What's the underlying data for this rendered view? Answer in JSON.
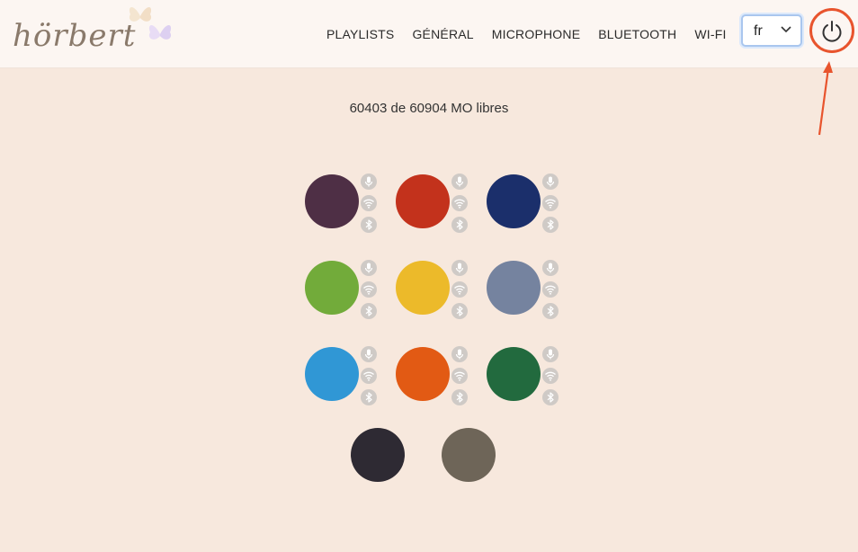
{
  "app": {
    "logo_text": "hörbert"
  },
  "nav": {
    "items": [
      "PLAYLISTS",
      "GÉNÉRAL",
      "MICROPHONE",
      "BLUETOOTH",
      "WI-FI"
    ]
  },
  "language": {
    "selected": "fr"
  },
  "storage": {
    "text": "60403 de 60904 MO libres"
  },
  "icons": {
    "power": "power-icon",
    "microphone": "microphone-icon",
    "wifi": "wifi-icon",
    "bluetooth": "bluetooth-icon",
    "chevron": "chevron-down-icon"
  },
  "colors": {
    "accent": "#e8542d",
    "page_bg": "#f7e8dd",
    "header_bg": "#fcf6f2"
  },
  "playlists": [
    {
      "color": "#4e2f45",
      "badges": true
    },
    {
      "color": "#c3321c",
      "badges": true
    },
    {
      "color": "#1b2f6b",
      "badges": true
    },
    {
      "color": "#72ab3a",
      "badges": true
    },
    {
      "color": "#ecba2a",
      "badges": true
    },
    {
      "color": "#75839f",
      "badges": true
    },
    {
      "color": "#3097d5",
      "badges": true
    },
    {
      "color": "#e25a14",
      "badges": true
    },
    {
      "color": "#226a3e",
      "badges": true
    },
    {
      "color": "#2e2a33",
      "badges": false
    },
    {
      "color": "#6e6558",
      "badges": false
    }
  ]
}
